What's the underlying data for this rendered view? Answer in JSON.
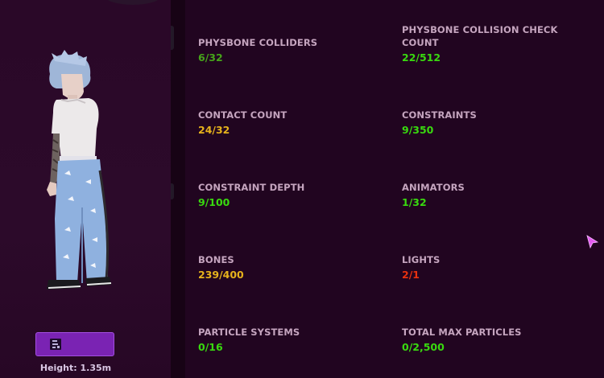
{
  "avatar": {
    "height_label": "Height: 1.35m"
  },
  "colors": {
    "ok": "#39d90f",
    "good": "#46a41a",
    "medium": "#e6b21c",
    "exceeded": "#e8310f",
    "label": "#c5a5bf"
  },
  "stats": [
    {
      "label": "PHYSBONE COLLIDERS",
      "value": "6/32",
      "status": "good"
    },
    {
      "label": "PHYSBONE COLLISION CHECK COUNT",
      "value": "22/512",
      "status": "ok"
    },
    {
      "label": "CONTACT COUNT",
      "value": "24/32",
      "status": "medium"
    },
    {
      "label": "CONSTRAINTS",
      "value": "9/350",
      "status": "ok"
    },
    {
      "label": "CONSTRAINT DEPTH",
      "value": "9/100",
      "status": "ok"
    },
    {
      "label": "ANIMATORS",
      "value": "1/32",
      "status": "ok"
    },
    {
      "label": "BONES",
      "value": "239/400",
      "status": "medium"
    },
    {
      "label": "LIGHTS",
      "value": "2/1",
      "status": "exceeded"
    },
    {
      "label": "PARTICLE SYSTEMS",
      "value": "0/16",
      "status": "ok"
    },
    {
      "label": "TOTAL MAX PARTICLES",
      "value": "0/2,500",
      "status": "ok"
    }
  ]
}
